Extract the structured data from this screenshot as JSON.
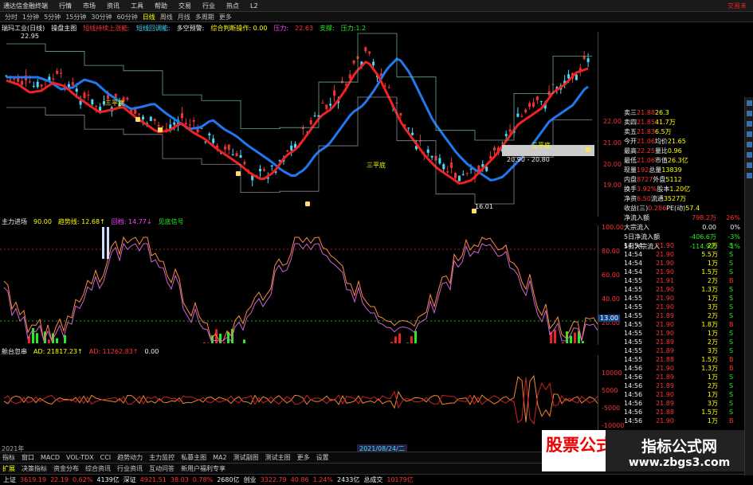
{
  "menu": {
    "app_title": "通达信金融终端",
    "items": [
      "行情",
      "市场",
      "资讯",
      "工具",
      "帮助",
      "交易",
      "行业",
      "热点",
      "L2"
    ],
    "trade": "交易未"
  },
  "toolbar": {
    "periods": [
      "分时",
      "1分钟",
      "5分钟",
      "15分钟",
      "30分钟",
      "60分钟",
      "日线",
      "周线",
      "月线",
      "多周期",
      "更多"
    ],
    "active": "日线"
  },
  "main_indicator": {
    "stock_name": "瑞玛工业(日线)",
    "items": [
      {
        "text": "操盘主图",
        "color": "#eee"
      },
      {
        "text": "短线持续上涨能:",
        "color": "#f33"
      },
      {
        "text": "短线回调能:",
        "color": "#4df"
      },
      {
        "text": "多空预警:",
        "color": "#eee"
      },
      {
        "text": "综合判断操作: 0.00",
        "color": "#ff0"
      },
      {
        "text": "压力:",
        "color": "#f4f"
      },
      {
        "text": "22.63",
        "color": "#f33"
      },
      {
        "text": "支撑:",
        "color": "#2e2"
      },
      {
        "text": "压力:1.2",
        "color": "#2e2"
      }
    ],
    "high_label": "22.95"
  },
  "chart_notes": {
    "sanping": "三平底",
    "price_box": "20.90 - 20.80",
    "low_label": "16.01"
  },
  "price_axis": [
    "22.00",
    "21.00",
    "20.00",
    "19.00"
  ],
  "quote_panel": {
    "ask": [
      {
        "label": "卖三",
        "price": "21.88",
        "vol": "26.3"
      },
      {
        "label": "卖四",
        "price": "21.85",
        "vol": "41.7万"
      },
      {
        "label": "卖五",
        "price": "21.83",
        "vol": "6.5万"
      }
    ],
    "rows": [
      [
        "今开",
        "21.06",
        "均价",
        "21.65"
      ],
      [
        "最高",
        "22.25",
        "量比",
        "0.96"
      ],
      [
        "最低",
        "21.06",
        "市值",
        "26.3亿"
      ],
      [
        "现量",
        "192",
        "总量",
        "13839"
      ],
      [
        "内盘",
        "8727",
        "外盘",
        "5112"
      ],
      [
        "换手",
        "3.92%",
        "股本",
        "1.20亿"
      ],
      [
        "净资",
        "6.50",
        "流通",
        "3527万"
      ],
      [
        "收益(三)",
        "0.286",
        "PE(动)",
        "57.4"
      ]
    ]
  },
  "net_flow": [
    {
      "label": "净流入额",
      "value": "798.2万",
      "pct": "26%",
      "color": "#f33"
    },
    {
      "label": "大宗流入",
      "value": "0.00",
      "pct": "0%",
      "color": "#eee"
    },
    {
      "label": "5日净流入额",
      "value": "-406.6万",
      "pct": "-3%",
      "color": "#2e2"
    },
    {
      "label": "5日大宗流入",
      "value": "-114.9万",
      "pct": "-1%",
      "color": "#2e2"
    }
  ],
  "ticks": [
    [
      "14:54",
      "21.90",
      "2万",
      "S"
    ],
    [
      "14:54",
      "21.90",
      "5.5万",
      "S"
    ],
    [
      "14:54",
      "21.90",
      "1万",
      "S"
    ],
    [
      "14:54",
      "21.90",
      "1.5万",
      "S"
    ],
    [
      "14:55",
      "21.91",
      "2万",
      "B"
    ],
    [
      "14:55",
      "21.90",
      "1.3万",
      "S"
    ],
    [
      "14:55",
      "21.90",
      "1万",
      "S"
    ],
    [
      "14:55",
      "21.90",
      "3万",
      "S"
    ],
    [
      "14:55",
      "21.89",
      "2万",
      "S"
    ],
    [
      "14:55",
      "21.90",
      "1.8万",
      "B"
    ],
    [
      "14:55",
      "21.90",
      "1万",
      "S"
    ],
    [
      "14:55",
      "21.89",
      "2万",
      "S"
    ],
    [
      "14:55",
      "21.89",
      "3万",
      "S"
    ],
    [
      "14:55",
      "21.88",
      "1.5万",
      "B"
    ],
    [
      "14:56",
      "21.90",
      "1.3万",
      "B"
    ],
    [
      "14:56",
      "21.89",
      "1万",
      "S"
    ],
    [
      "14:56",
      "21.89",
      "2万",
      "S"
    ],
    [
      "14:56",
      "21.90",
      "1万",
      "S"
    ],
    [
      "14:56",
      "21.89",
      "3万",
      "S"
    ],
    [
      "14:56",
      "21.88",
      "1.5万",
      "S"
    ],
    [
      "14:56",
      "21.90",
      "1万",
      "B"
    ]
  ],
  "sub1": {
    "title": "主力进场",
    "items": [
      {
        "text": "90.00",
        "color": "#ff0"
      },
      {
        "text": "趋势线: 12.68↑",
        "color": "#ff0"
      },
      {
        "text": "回档: 14.77↓",
        "color": "#f4f"
      },
      {
        "text": "见底信号",
        "color": "#2e2"
      }
    ],
    "axis": [
      "100.00",
      "80.00",
      "60.00",
      "40.00",
      "20.00"
    ],
    "current": "13.00"
  },
  "sub2": {
    "title": "舱台忽串",
    "items": [
      {
        "text": "AD: 21817.23↑",
        "color": "#ff0"
      },
      {
        "text": "AD: 11262.83↑",
        "color": "#f33"
      },
      {
        "text": "0.00",
        "color": "#eee"
      }
    ],
    "axis": [
      "10000",
      "5000",
      "-5000",
      "-10000"
    ]
  },
  "date_axis": {
    "start": "2021年",
    "cursor": "2021/08/24/二"
  },
  "bottom_tabs": [
    "指标",
    "窗口",
    "MACD",
    "VOL-TDX",
    "CCI",
    "趋势动力",
    "主力监控",
    "私募主图",
    "MA2",
    "测试副图",
    "测试主图",
    "更多",
    "设置"
  ],
  "bottom_tabs_row2": [
    "扩展",
    "决策指标",
    "资金分布",
    "综合资讯",
    "行业资讯",
    "互动问答",
    "新用户福利专享"
  ],
  "status": [
    {
      "label": "上证",
      "value": "3619.19",
      "chg": "22.19",
      "pct": "0.62%",
      "amt": "4139亿"
    },
    {
      "label": "深证",
      "value": "4921.51",
      "chg": "38.03",
      "pct": "0.78%",
      "amt": "2680亿"
    },
    {
      "label": "创业",
      "value": "3322.79",
      "chg": "40.86",
      "pct": "1.24%",
      "amt": "2433亿"
    },
    {
      "label": "总成交",
      "value": "10179亿",
      "chg": "",
      "pct": "",
      "amt": ""
    }
  ],
  "watermark": {
    "left": "股票公式指标网",
    "url": "www.zbgs3.com",
    "brand": "指标公式网"
  },
  "colors": {
    "up": "#ff3333",
    "down": "#22ee22",
    "ma_red": "#ee2222",
    "ma_blue": "#2277ee",
    "cyan": "#44ddff"
  }
}
